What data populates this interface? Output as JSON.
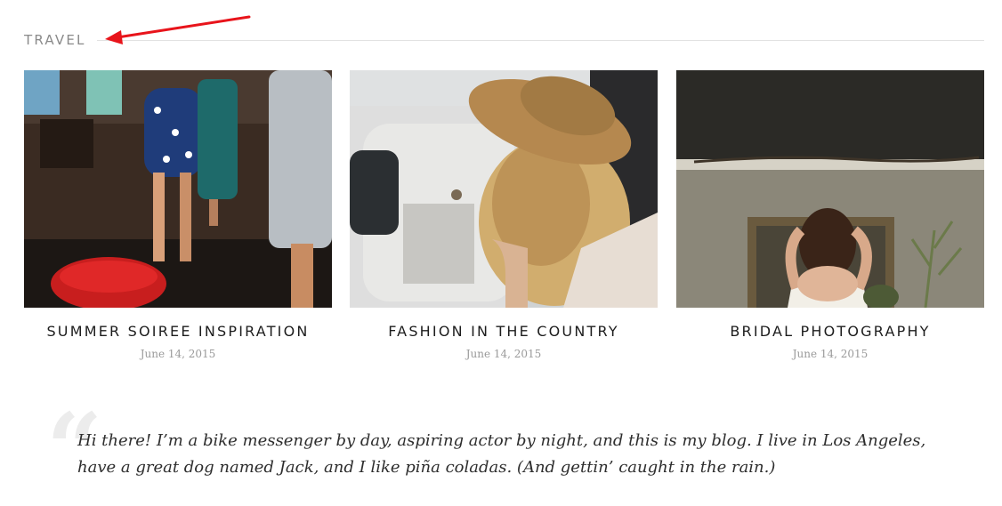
{
  "section": {
    "title": "TRAVEL"
  },
  "posts": [
    {
      "title": "SUMMER SOIREE INSPIRATION",
      "date": "June 14, 2015",
      "image": "party-guests-photo"
    },
    {
      "title": "FASHION IN THE COUNTRY",
      "date": "June 14, 2015",
      "image": "woman-straw-hat-truck-photo"
    },
    {
      "title": "BRIDAL PHOTOGRAPHY",
      "date": "June 14, 2015",
      "image": "bride-hair-photo"
    }
  ],
  "quote": {
    "text": "Hi there! I’m a bike messenger by day, aspiring actor by night, and this is my blog. I live in Los Angeles, have a great dog named Jack, and I like piña coladas. (And gettin’ caught in the rain.)"
  },
  "colors": {
    "annotation_arrow": "#e8141b",
    "title_text": "#1d1d1d",
    "date_text": "#9a9a9a",
    "section_text": "#8a8a8a"
  }
}
